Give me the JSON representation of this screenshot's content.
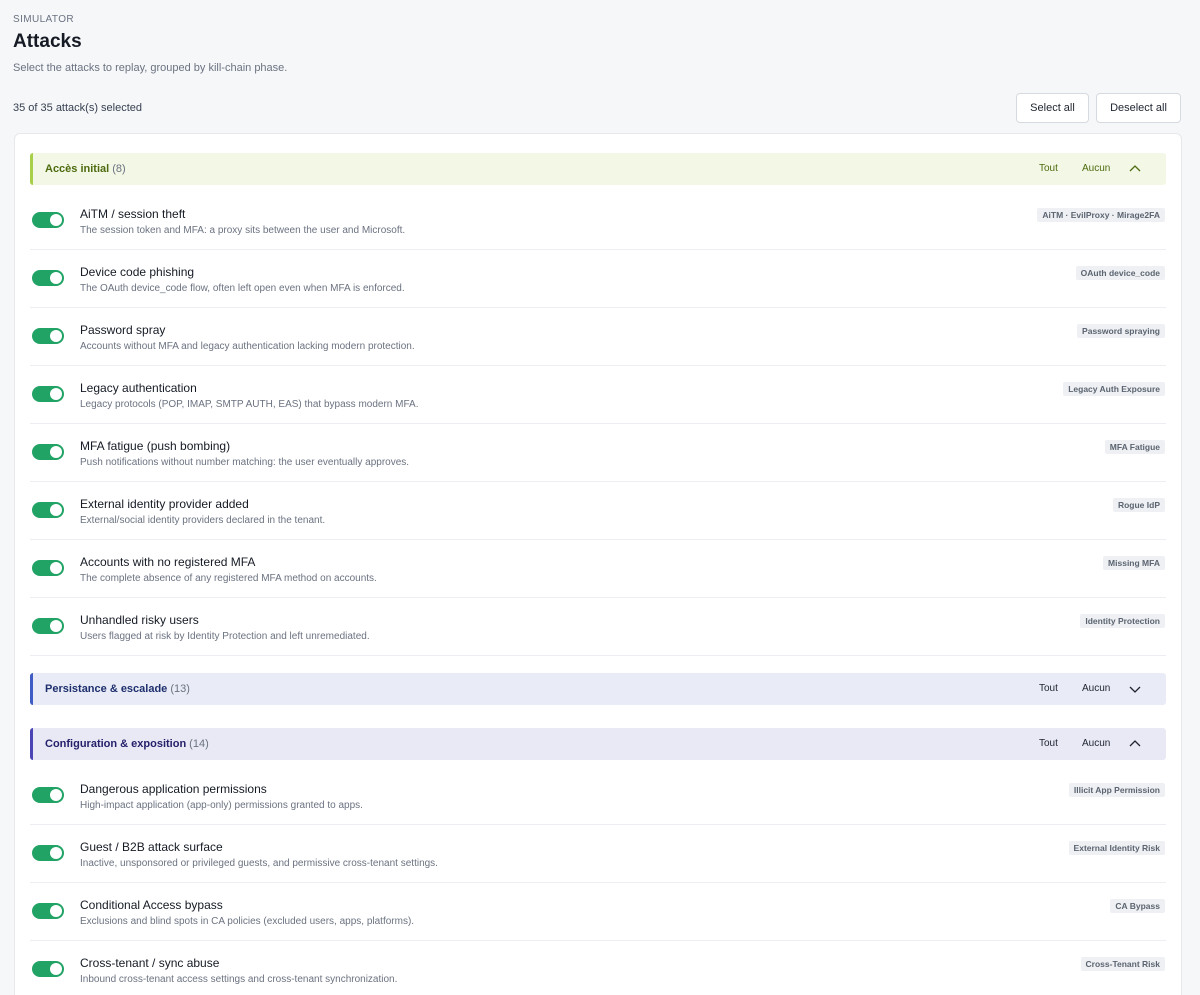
{
  "header": {
    "eyebrow": "SIMULATOR",
    "title": "Attacks",
    "subtitle": "Select the attacks to replay, grouped by kill-chain phase."
  },
  "toolbar": {
    "selected_text": "35 of 35 attack(s) selected",
    "select_all_label": "Select all",
    "deselect_all_label": "Deselect all"
  },
  "colors": {
    "toggle_on": "#22a366",
    "group_initial": "#a8cf4a",
    "group_persistence": "#3f5bc4",
    "group_config": "#4b44b4"
  },
  "groups": [
    {
      "name": "Accès initial",
      "count": "(8)",
      "all_label": "Tout",
      "none_label": "Aucun",
      "expanded": true,
      "chevron_icon": "chevron-up-icon",
      "items": [
        {
          "title": "AiTM / session theft",
          "desc": "The session token and MFA: a proxy sits between the user and Microsoft.",
          "tag": "AiTM · EvilProxy · Mirage2FA",
          "enabled": true
        },
        {
          "title": "Device code phishing",
          "desc": "The OAuth device_code flow, often left open even when MFA is enforced.",
          "tag": "OAuth device_code",
          "enabled": true
        },
        {
          "title": "Password spray",
          "desc": "Accounts without MFA and legacy authentication lacking modern protection.",
          "tag": "Password spraying",
          "enabled": true
        },
        {
          "title": "Legacy authentication",
          "desc": "Legacy protocols (POP, IMAP, SMTP AUTH, EAS) that bypass modern MFA.",
          "tag": "Legacy Auth Exposure",
          "enabled": true
        },
        {
          "title": "MFA fatigue (push bombing)",
          "desc": "Push notifications without number matching: the user eventually approves.",
          "tag": "MFA Fatigue",
          "enabled": true
        },
        {
          "title": "External identity provider added",
          "desc": "External/social identity providers declared in the tenant.",
          "tag": "Rogue IdP",
          "enabled": true
        },
        {
          "title": "Accounts with no registered MFA",
          "desc": "The complete absence of any registered MFA method on accounts.",
          "tag": "Missing MFA",
          "enabled": true
        },
        {
          "title": "Unhandled risky users",
          "desc": "Users flagged at risk by Identity Protection and left unremediated.",
          "tag": "Identity Protection",
          "enabled": true
        }
      ]
    },
    {
      "name": "Persistance & escalade",
      "count": "(13)",
      "all_label": "Tout",
      "none_label": "Aucun",
      "expanded": false,
      "chevron_icon": "chevron-down-icon",
      "items": []
    },
    {
      "name": "Configuration & exposition",
      "count": "(14)",
      "all_label": "Tout",
      "none_label": "Aucun",
      "expanded": true,
      "chevron_icon": "chevron-up-icon",
      "items": [
        {
          "title": "Dangerous application permissions",
          "desc": "High-impact application (app-only) permissions granted to apps.",
          "tag": "Illicit App Permission",
          "enabled": true
        },
        {
          "title": "Guest / B2B attack surface",
          "desc": "Inactive, unsponsored or privileged guests, and permissive cross-tenant settings.",
          "tag": "External Identity Risk",
          "enabled": true
        },
        {
          "title": "Conditional Access bypass",
          "desc": "Exclusions and blind spots in CA policies (excluded users, apps, platforms).",
          "tag": "CA Bypass",
          "enabled": true
        },
        {
          "title": "Cross-tenant / sync abuse",
          "desc": "Inbound cross-tenant access settings and cross-tenant synchronization.",
          "tag": "Cross-Tenant Risk",
          "enabled": true
        }
      ]
    }
  ]
}
